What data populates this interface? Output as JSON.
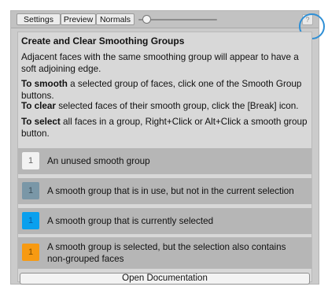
{
  "toolbar": {
    "tabs": [
      "Settings",
      "Preview",
      "Normals"
    ],
    "slider_value": 0.05,
    "help_label": "?"
  },
  "content": {
    "heading": "Create and Clear Smoothing Groups",
    "intro": "Adjacent faces with the same smoothing group will appear to have a soft adjoining edge.",
    "smooth_bold": "To smooth",
    "smooth_rest": " a selected group of faces, click one of the Smooth Group buttons.",
    "clear_bold": "To clear",
    "clear_rest": " selected faces of their smooth group, click the [Break] icon.",
    "select_bold": "To select",
    "select_rest": " all faces in a group, Right+Click or Alt+Click a smooth group button."
  },
  "legend": [
    {
      "number": "1",
      "label": "An unused smooth group",
      "color": "#f2f2f2",
      "text_color": "#666666"
    },
    {
      "number": "1",
      "label": "A smooth group that is in use, but not in the current selection",
      "color": "#7a97a7",
      "text_color": "#3d4f5a"
    },
    {
      "number": "1",
      "label": "A smooth group that is currently selected",
      "color": "#0aa0ee",
      "text_color": "#0a5aa0"
    },
    {
      "number": "1",
      "label": "A smooth group is selected, but the selection also contains non-grouped faces",
      "color": "#f79a12",
      "text_color": "#7a4a00"
    }
  ],
  "footer": {
    "doc_button": "Open Documentation"
  }
}
